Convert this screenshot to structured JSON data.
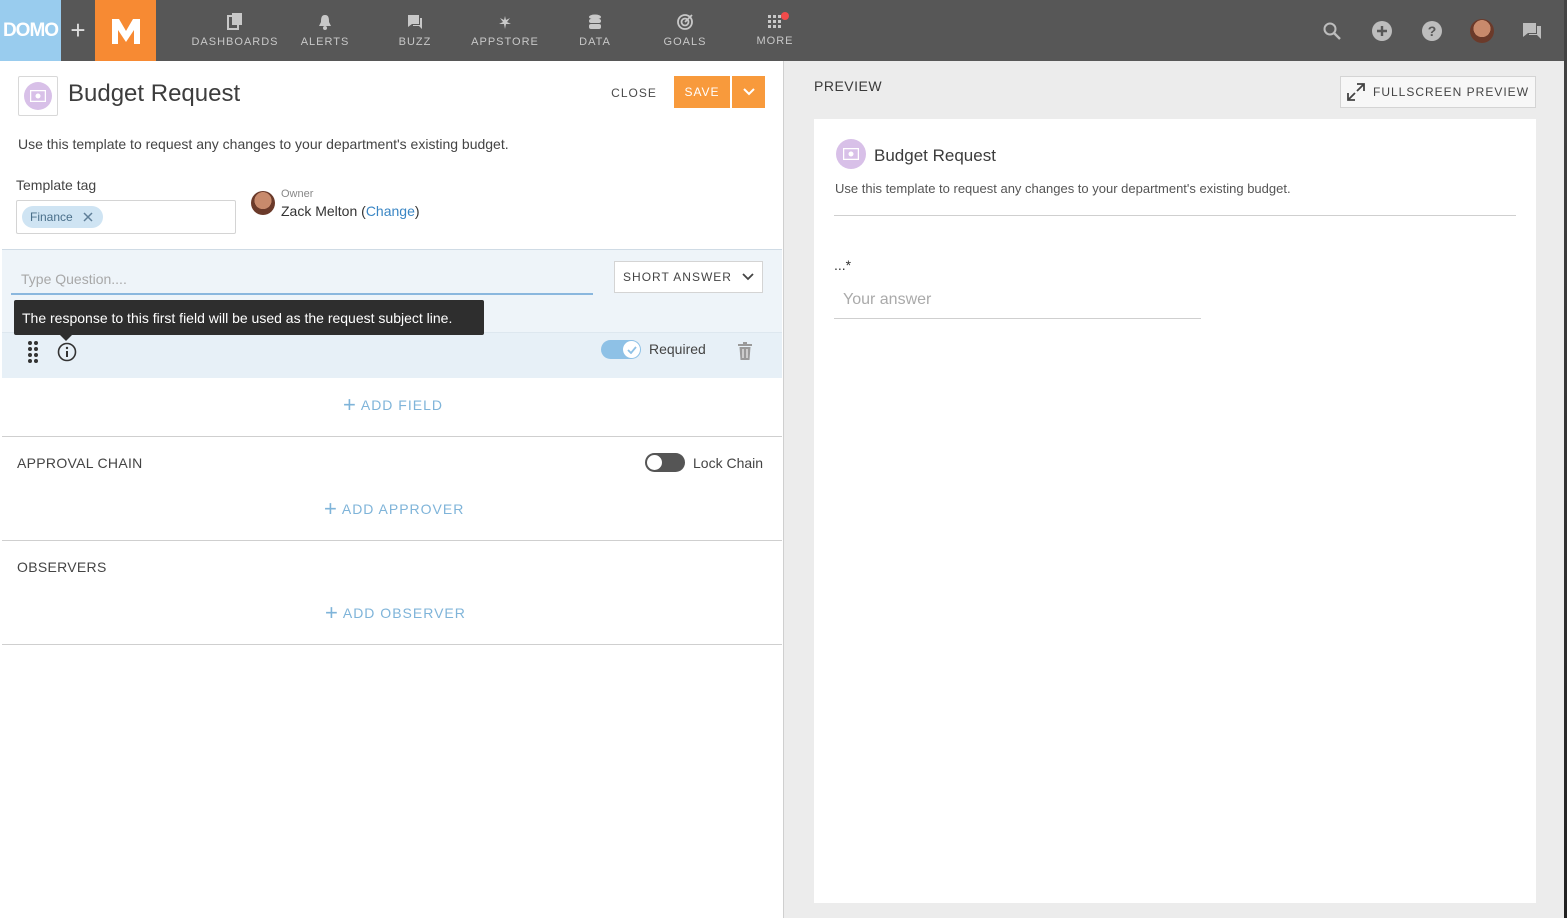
{
  "topbar": {
    "logo_text": "DOMO",
    "nav": [
      {
        "label": "DASHBOARDS",
        "icon": "dashboards-icon"
      },
      {
        "label": "ALERTS",
        "icon": "bell-icon"
      },
      {
        "label": "BUZZ",
        "icon": "chat-icon"
      },
      {
        "label": "APPSTORE",
        "icon": "appstore-icon"
      },
      {
        "label": "DATA",
        "icon": "database-icon"
      },
      {
        "label": "GOALS",
        "icon": "target-icon"
      },
      {
        "label": "MORE",
        "icon": "grid-icon"
      }
    ]
  },
  "editor": {
    "title": "Budget Request",
    "close_label": "CLOSE",
    "save_label": "SAVE",
    "description": "Use this template to request any changes to your department's existing budget.",
    "template_tag_label": "Template tag",
    "tag": "Finance",
    "owner_label": "Owner",
    "owner_name": "Zack Melton",
    "owner_change": "Change",
    "question_placeholder": "Type Question....",
    "answer_type": "SHORT ANSWER",
    "tooltip": "The response to this first field will be used as the request subject line.",
    "required_label": "Required",
    "add_field": "ADD FIELD",
    "approval_chain": "APPROVAL CHAIN",
    "lock_chain": "Lock Chain",
    "add_approver": "ADD APPROVER",
    "observers": "OBSERVERS",
    "add_observer": "ADD OBSERVER"
  },
  "preview": {
    "label": "PREVIEW",
    "fullscreen": "FULLSCREEN PREVIEW",
    "title": "Budget Request",
    "description": "Use this template to request any changes to your department's existing budget.",
    "question": "...*",
    "answer_placeholder": "Your answer"
  },
  "colors": {
    "accent_orange": "#f89a3c",
    "link_blue": "#3a86c4",
    "nav_bg": "#575757"
  }
}
